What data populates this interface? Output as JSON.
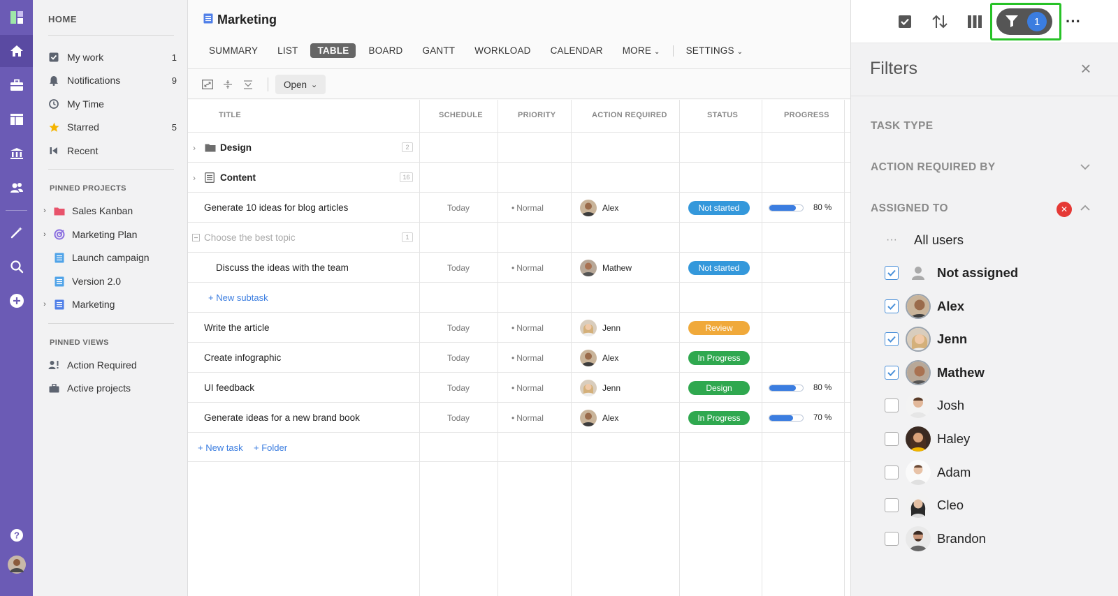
{
  "sidebar": {
    "home": "HOME",
    "items": [
      {
        "label": "My work",
        "count": "1",
        "icon": "check-square-icon"
      },
      {
        "label": "Notifications",
        "count": "9",
        "icon": "bell-icon"
      },
      {
        "label": "My Time",
        "count": "",
        "icon": "clock-icon"
      },
      {
        "label": "Starred",
        "count": "5",
        "icon": "star-icon"
      },
      {
        "label": "Recent",
        "count": "",
        "icon": "history-icon"
      }
    ],
    "pinned_projects_title": "PINNED PROJECTS",
    "projects": [
      {
        "label": "Sales Kanban",
        "icon": "folder-icon",
        "expandable": true
      },
      {
        "label": "Marketing Plan",
        "icon": "target-icon",
        "expandable": true
      },
      {
        "label": "Launch campaign",
        "icon": "list-icon",
        "expandable": false
      },
      {
        "label": "Version 2.0",
        "icon": "list-icon",
        "expandable": false
      },
      {
        "label": "Marketing",
        "icon": "list-icon",
        "expandable": true
      }
    ],
    "pinned_views_title": "PINNED VIEWS",
    "views": [
      {
        "label": "Action Required",
        "icon": "user-alert-icon"
      },
      {
        "label": "Active projects",
        "icon": "briefcase-icon"
      }
    ]
  },
  "header": {
    "title": "Marketing",
    "tabs": [
      "SUMMARY",
      "LIST",
      "TABLE",
      "BOARD",
      "GANTT",
      "WORKLOAD",
      "CALENDAR",
      "MORE"
    ],
    "active_tab": "TABLE",
    "settings": "SETTINGS"
  },
  "toolbar": {
    "open_label": "Open"
  },
  "table": {
    "columns": [
      "TITLE",
      "SCHEDULE",
      "PRIORITY",
      "ACTION REQUIRED",
      "STATUS",
      "PROGRESS"
    ],
    "rows": [
      {
        "kind": "folder",
        "title": "Design",
        "badge": "2"
      },
      {
        "kind": "folder",
        "title": "Content",
        "badge": "16"
      },
      {
        "kind": "task",
        "title": "Generate 10 ideas for blog articles",
        "schedule": "Today",
        "priority": "Normal",
        "assignee": "Alex",
        "status": "Not started",
        "status_color": "#3498db",
        "progress": 80,
        "progress_label": "80 %"
      },
      {
        "kind": "group",
        "title": "Choose the best topic",
        "badge": "1"
      },
      {
        "kind": "subtask",
        "title": "Discuss the ideas with the team",
        "schedule": "Today",
        "priority": "Normal",
        "assignee": "Mathew",
        "status": "Not started",
        "status_color": "#3498db"
      },
      {
        "kind": "link",
        "title": "+ New subtask"
      },
      {
        "kind": "task",
        "title": "Write the article",
        "schedule": "Today",
        "priority": "Normal",
        "assignee": "Jenn",
        "status": "Review",
        "status_color": "#f0a93a"
      },
      {
        "kind": "task",
        "title": "Create infographic",
        "schedule": "Today",
        "priority": "Normal",
        "assignee": "Alex",
        "status": "In Progress",
        "status_color": "#2fa84f"
      },
      {
        "kind": "task",
        "title": "UI feedback",
        "schedule": "Today",
        "priority": "Normal",
        "assignee": "Jenn",
        "status": "Design",
        "status_color": "#2fa84f",
        "progress": 80,
        "progress_label": "80 %"
      },
      {
        "kind": "task",
        "title": "Generate ideas for a new brand book",
        "schedule": "Today",
        "priority": "Normal",
        "assignee": "Alex",
        "status": "In Progress",
        "status_color": "#2fa84f",
        "progress": 70,
        "progress_label": "70 %"
      }
    ],
    "new_task": "+ New task",
    "new_folder": "+ Folder"
  },
  "filters": {
    "title": "Filters",
    "active_count": "1",
    "sections": [
      "TASK TYPE",
      "ACTION REQUIRED BY",
      "ASSIGNED TO"
    ],
    "all_users": "All users",
    "users": [
      {
        "name": "Not assigned",
        "checked": true,
        "bold": true
      },
      {
        "name": "Alex",
        "checked": true,
        "bold": true
      },
      {
        "name": "Jenn",
        "checked": true,
        "bold": true
      },
      {
        "name": "Mathew",
        "checked": true,
        "bold": true
      },
      {
        "name": "Josh",
        "checked": false,
        "bold": false
      },
      {
        "name": "Haley",
        "checked": false,
        "bold": false
      },
      {
        "name": "Adam",
        "checked": false,
        "bold": false
      },
      {
        "name": "Cleo",
        "checked": false,
        "bold": false
      },
      {
        "name": "Brandon",
        "checked": false,
        "bold": false
      }
    ]
  },
  "colors": {
    "rail": "#6b5bb5",
    "accent": "#3b7de0",
    "highlight": "#27c227"
  }
}
